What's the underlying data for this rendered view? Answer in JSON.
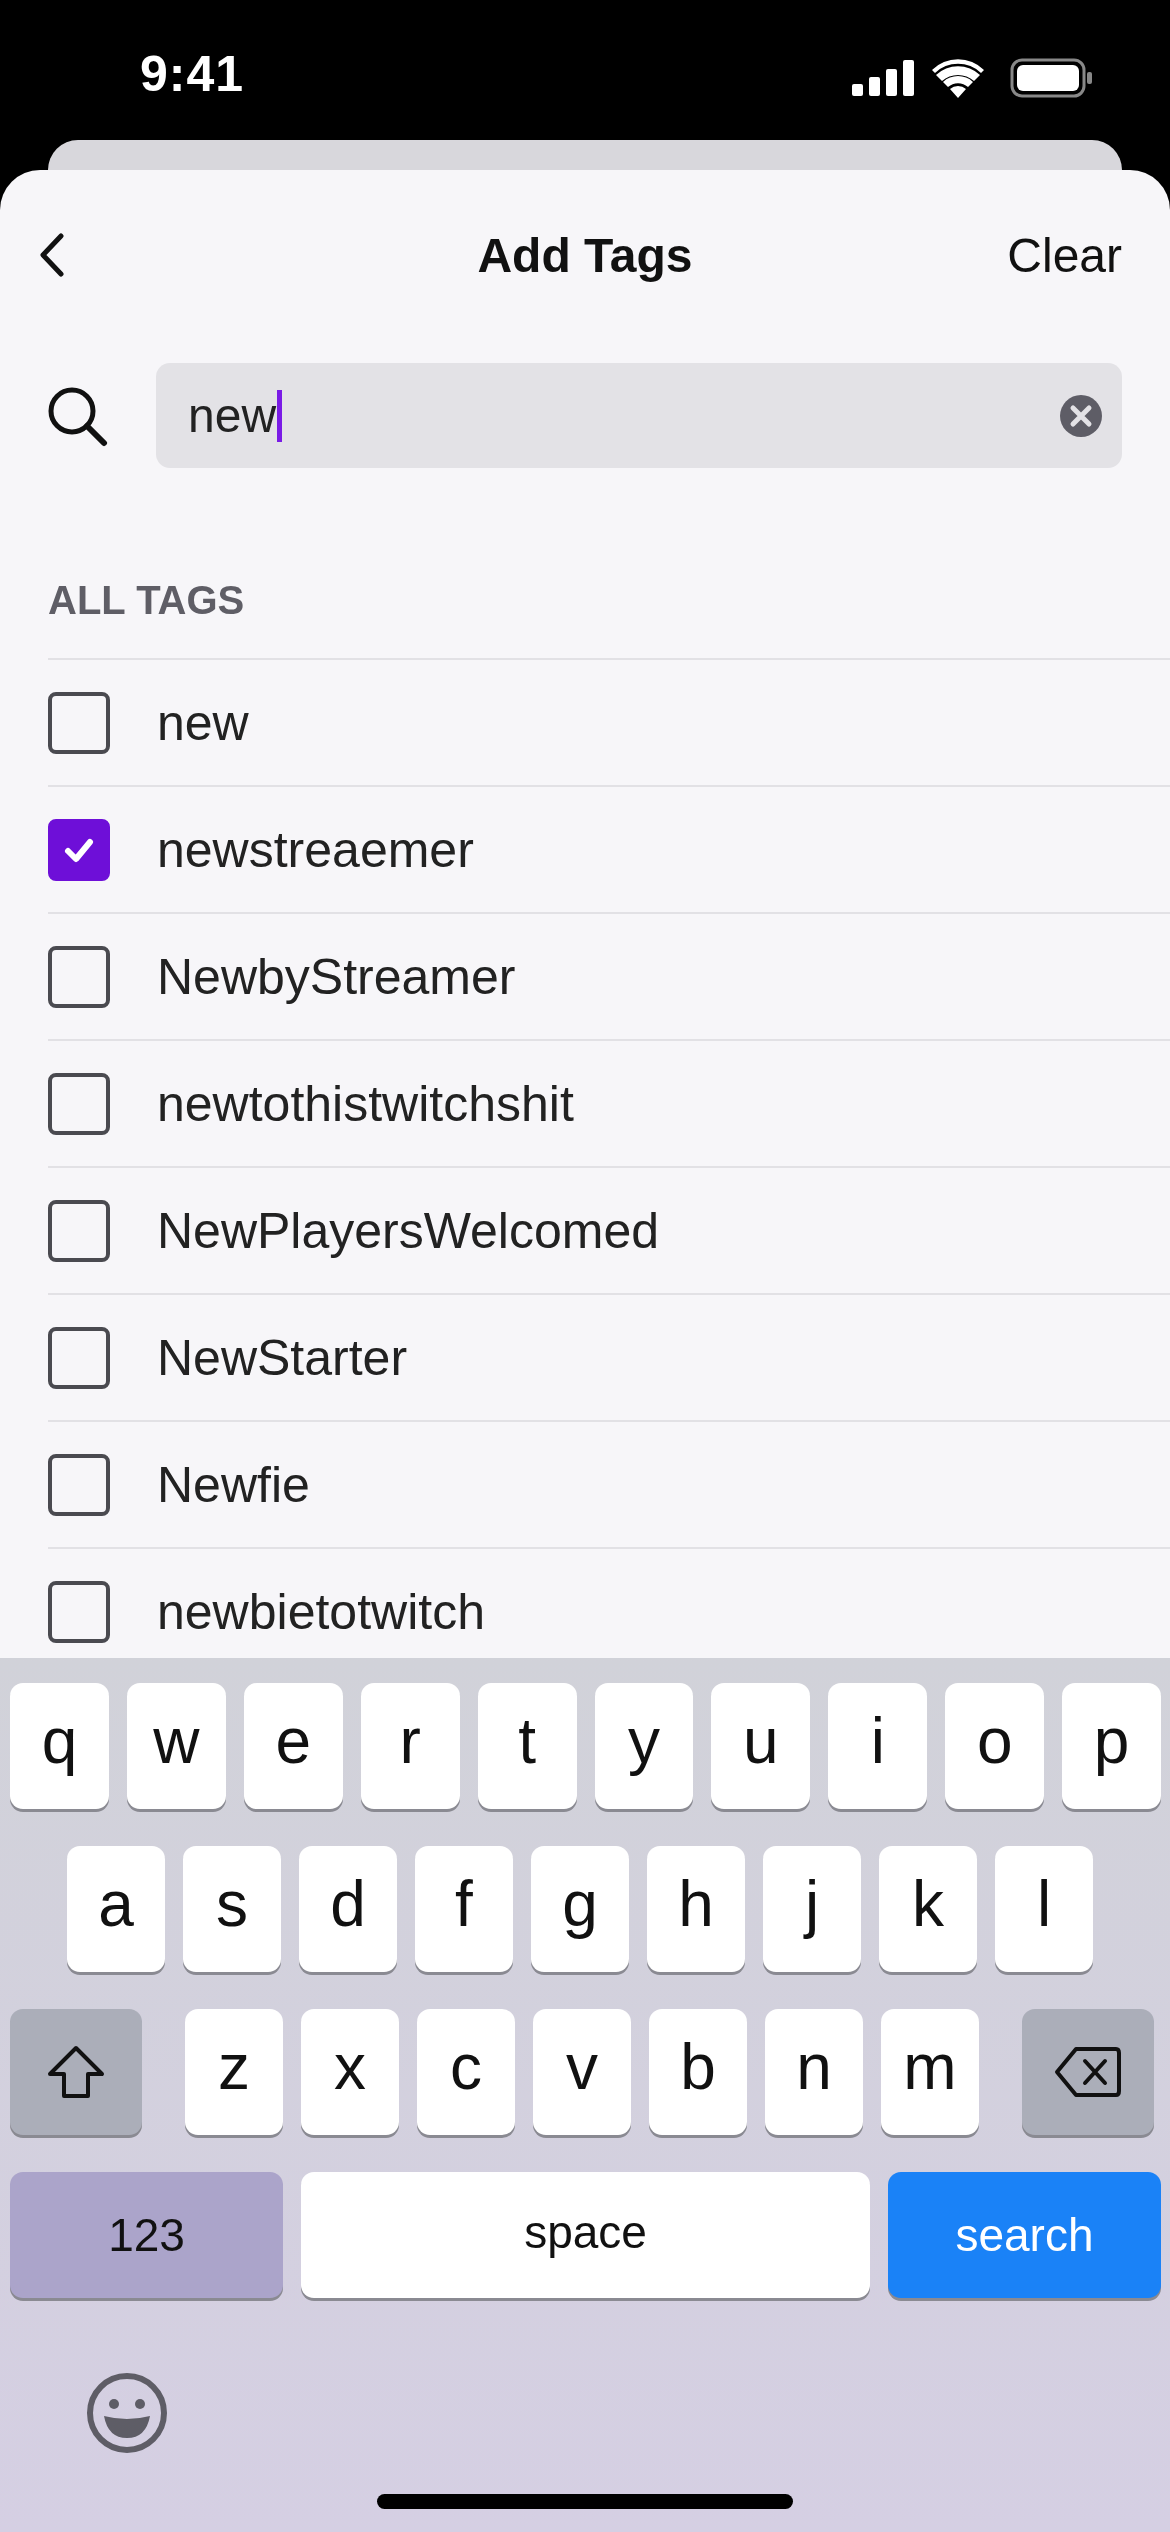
{
  "status_bar": {
    "time": "9:41"
  },
  "header": {
    "title": "Add Tags",
    "action": "Clear"
  },
  "search": {
    "value": "new"
  },
  "section": {
    "title": "ALL TAGS"
  },
  "tags": [
    {
      "label": "new",
      "checked": false
    },
    {
      "label": "newstreaemer",
      "checked": true
    },
    {
      "label": "NewbyStreamer",
      "checked": false
    },
    {
      "label": "newtothistwitchshit",
      "checked": false
    },
    {
      "label": "NewPlayersWelcomed",
      "checked": false
    },
    {
      "label": "NewStarter",
      "checked": false
    },
    {
      "label": "Newfie",
      "checked": false
    },
    {
      "label": "newbietotwitch",
      "checked": false
    }
  ],
  "keyboard": {
    "letter_rows": [
      [
        {
          "kind": "letter",
          "label": "q"
        },
        {
          "kind": "letter",
          "label": "w"
        },
        {
          "kind": "letter",
          "label": "e"
        },
        {
          "kind": "letter",
          "label": "r"
        },
        {
          "kind": "letter",
          "label": "t"
        },
        {
          "kind": "letter",
          "label": "y"
        },
        {
          "kind": "letter",
          "label": "u"
        },
        {
          "kind": "letter",
          "label": "i"
        },
        {
          "kind": "letter",
          "label": "o"
        },
        {
          "kind": "letter",
          "label": "p"
        }
      ],
      [
        {
          "kind": "letter",
          "label": "a"
        },
        {
          "kind": "letter",
          "label": "s"
        },
        {
          "kind": "letter",
          "label": "d"
        },
        {
          "kind": "letter",
          "label": "f"
        },
        {
          "kind": "letter",
          "label": "g"
        },
        {
          "kind": "letter",
          "label": "h"
        },
        {
          "kind": "letter",
          "label": "j"
        },
        {
          "kind": "letter",
          "label": "k"
        },
        {
          "kind": "letter",
          "label": "l"
        }
      ],
      [
        {
          "kind": "shift"
        },
        {
          "kind": "letter",
          "label": "z"
        },
        {
          "kind": "letter",
          "label": "x"
        },
        {
          "kind": "letter",
          "label": "c"
        },
        {
          "kind": "letter",
          "label": "v"
        },
        {
          "kind": "letter",
          "label": "b"
        },
        {
          "kind": "letter",
          "label": "n"
        },
        {
          "kind": "letter",
          "label": "m"
        },
        {
          "kind": "delete"
        }
      ]
    ],
    "bottom_keys": [
      {
        "kind": "numbers",
        "label": "123"
      },
      {
        "kind": "space",
        "label": "space"
      },
      {
        "kind": "search",
        "label": "search"
      }
    ]
  }
}
